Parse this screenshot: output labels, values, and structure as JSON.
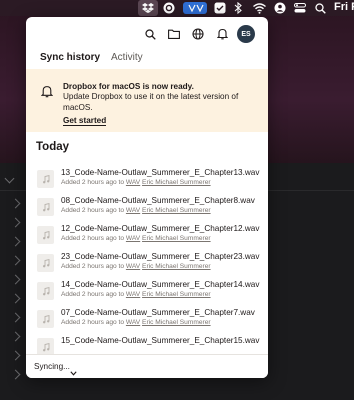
{
  "menubar": {
    "right_text": "Fri Fe",
    "icons": [
      "dropbox-icon",
      "creative-cloud-icon",
      "vpn-icon",
      "checkmark-app-icon",
      "bluetooth-icon",
      "wifi-icon",
      "user-icon",
      "control-center-icon",
      "search-icon"
    ]
  },
  "toolbar": {
    "icons": [
      "search-icon",
      "folder-icon",
      "globe-icon",
      "bell-icon"
    ],
    "avatar_initials": "ES"
  },
  "tabs": [
    {
      "label": "Sync history",
      "active": true
    },
    {
      "label": "Activity",
      "active": false
    }
  ],
  "banner": {
    "title": "Dropbox for macOS is now ready.",
    "body": "Update Dropbox to use it on the latest version of macOS.",
    "link": "Get started"
  },
  "section": {
    "heading": "Today"
  },
  "files": [
    {
      "name": "13_Code-Name-Outlaw_Summerer_E_Chapter13.wav",
      "time": "Added 2 hours ago to",
      "folder": "WAV",
      "author": "Eric Michael Summerer"
    },
    {
      "name": "08_Code-Name-Outlaw_Summerer_E_Chapter8.wav",
      "time": "Added 2 hours ago to",
      "folder": "WAV",
      "author": "Eric Michael Summerer"
    },
    {
      "name": "12_Code-Name-Outlaw_Summerer_E_Chapter12.wav",
      "time": "Added 2 hours ago to",
      "folder": "WAV",
      "author": "Eric Michael Summerer"
    },
    {
      "name": "23_Code-Name-Outlaw_Summerer_E_Chapter23.wav",
      "time": "Added 2 hours ago to",
      "folder": "WAV",
      "author": "Eric Michael Summerer"
    },
    {
      "name": "14_Code-Name-Outlaw_Summerer_E_Chapter14.wav",
      "time": "Added 2 hours ago to",
      "folder": "WAV",
      "author": "Eric Michael Summerer"
    },
    {
      "name": "07_Code-Name-Outlaw_Summerer_E_Chapter7.wav",
      "time": "Added 2 hours ago to",
      "folder": "WAV",
      "author": "Eric Michael Summerer"
    },
    {
      "name": "15_Code-Name-Outlaw_Summerer_E_Chapter15.wav",
      "time": "",
      "folder": "",
      "author": ""
    }
  ],
  "footer": {
    "status": "Syncing..."
  },
  "colors": {
    "banner_bg": "#fdf2e0",
    "avatar_bg": "#2a3a4a",
    "text": "#1e1919"
  }
}
